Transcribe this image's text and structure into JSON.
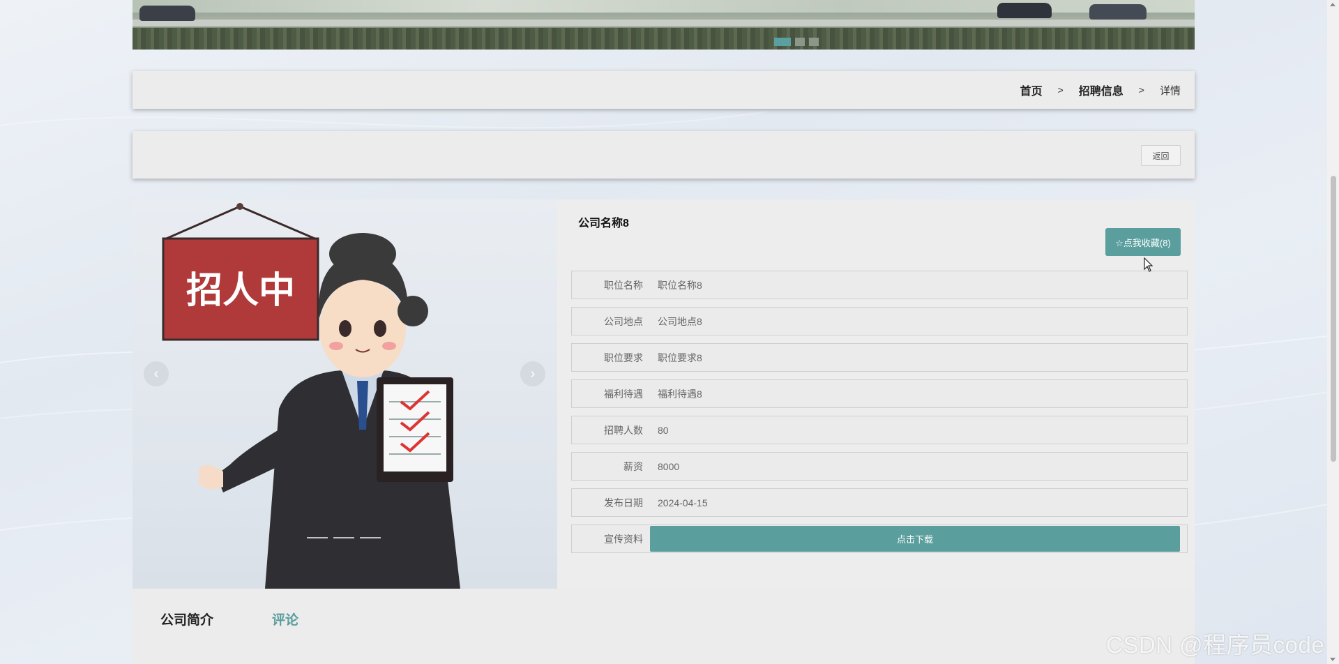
{
  "breadcrumb": {
    "home": "首页",
    "separator": ">",
    "section": "招聘信息",
    "current": "详情"
  },
  "back_label": "返回",
  "carousel": {
    "sign_text": "招人中",
    "prev_glyph": "‹",
    "next_glyph": "›"
  },
  "job": {
    "company_name": "公司名称8",
    "favorite_label": "☆点我收藏(8)",
    "fields": [
      {
        "label": "职位名称",
        "value": "职位名称8"
      },
      {
        "label": "公司地点",
        "value": "公司地点8"
      },
      {
        "label": "职位要求",
        "value": "职位要求8"
      },
      {
        "label": "福利待遇",
        "value": "福利待遇8"
      },
      {
        "label": "招聘人数",
        "value": "80"
      },
      {
        "label": "薪资",
        "value": "8000"
      },
      {
        "label": "发布日期",
        "value": "2024-04-15"
      }
    ],
    "material_label": "宣传资料",
    "download_label": "点击下载"
  },
  "tabs": {
    "intro": "公司简介",
    "comment": "评论"
  },
  "watermark": "CSDN @程序员code",
  "colors": {
    "accent": "#5a9e9d",
    "panel": "#ededed",
    "sign_red": "#b03a3a"
  }
}
